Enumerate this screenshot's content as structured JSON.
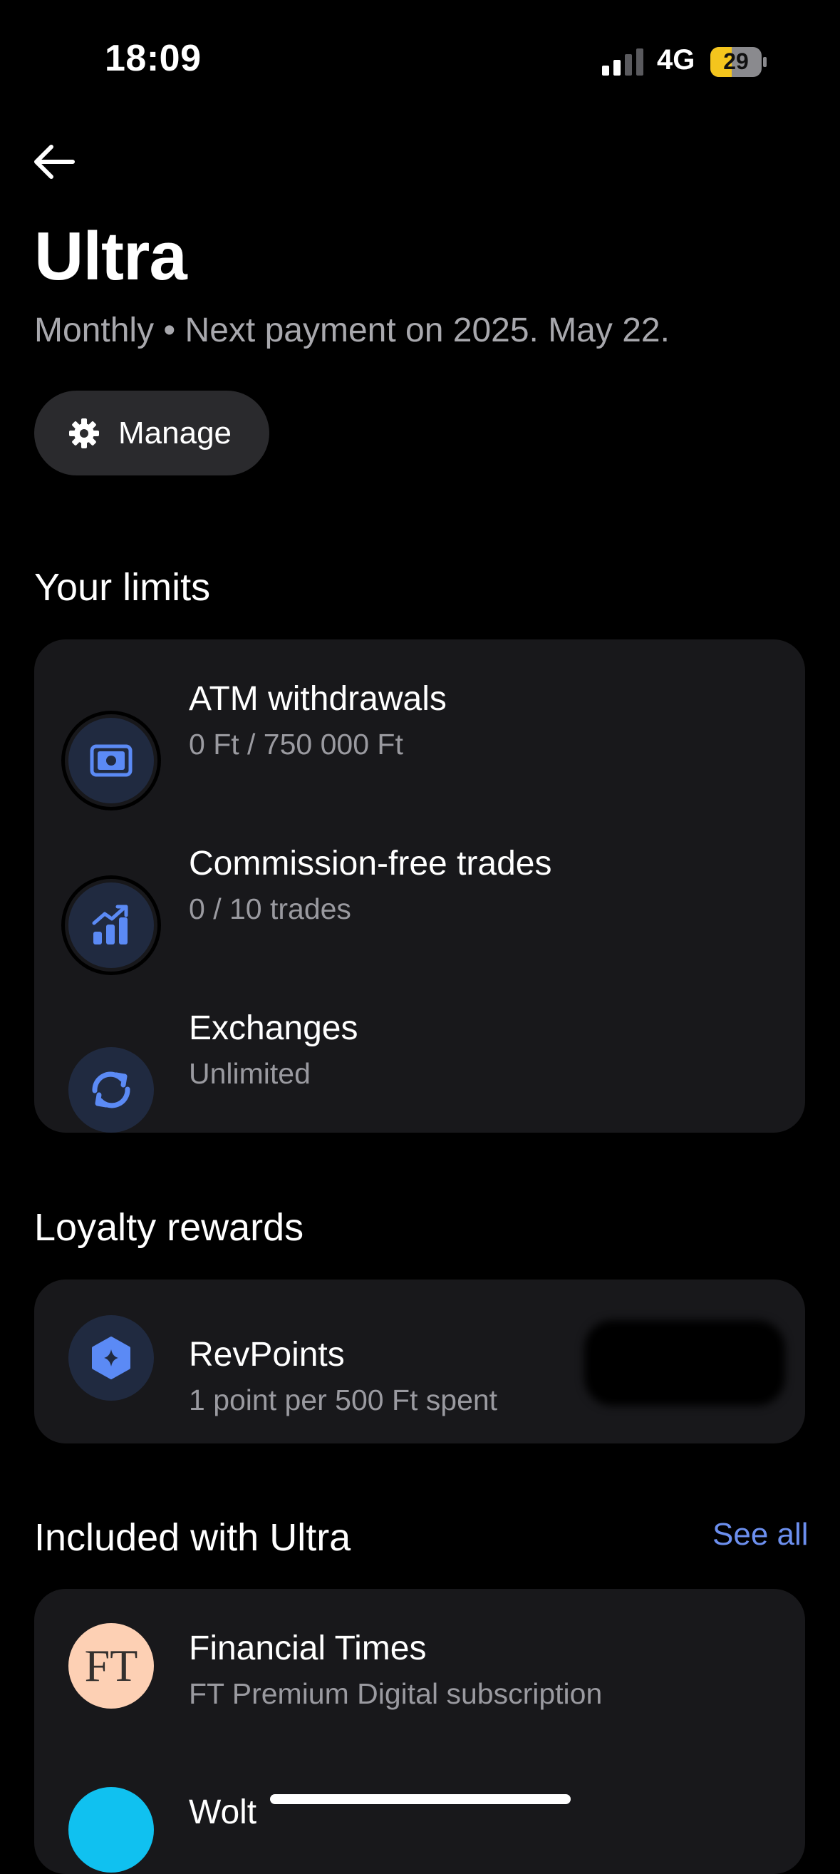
{
  "status_bar": {
    "time": "18:09",
    "network": "4G",
    "battery": "29",
    "battery_color": "#f4c51d"
  },
  "header": {
    "title": "Ultra",
    "subtitle": "Monthly • Next payment on 2025. May 22.",
    "manage_label": "Manage"
  },
  "limits": {
    "title": "Your limits",
    "items": [
      {
        "icon": "cash-icon",
        "title": "ATM withdrawals",
        "value": "0 Ft / 750 000 Ft"
      },
      {
        "icon": "chart-up-icon",
        "title": "Commission-free trades",
        "value": "0 / 10 trades"
      },
      {
        "icon": "exchange-icon",
        "title": "Exchanges",
        "value": "Unlimited"
      }
    ]
  },
  "loyalty": {
    "title": "Loyalty rewards",
    "item": {
      "icon": "revpoints-icon",
      "title": "RevPoints",
      "value": "1 point per 500 Ft spent"
    }
  },
  "included": {
    "title": "Included with Ultra",
    "see_all": "See all",
    "items": [
      {
        "logo": "FT",
        "title": "Financial Times",
        "value": "FT Premium Digital subscription"
      },
      {
        "logo": "wolt-logo",
        "title": "Wolt"
      }
    ]
  },
  "colors": {
    "accent": "#6c8fee",
    "icon_blue": "#5b8af5",
    "card_bg": "#18181b"
  }
}
